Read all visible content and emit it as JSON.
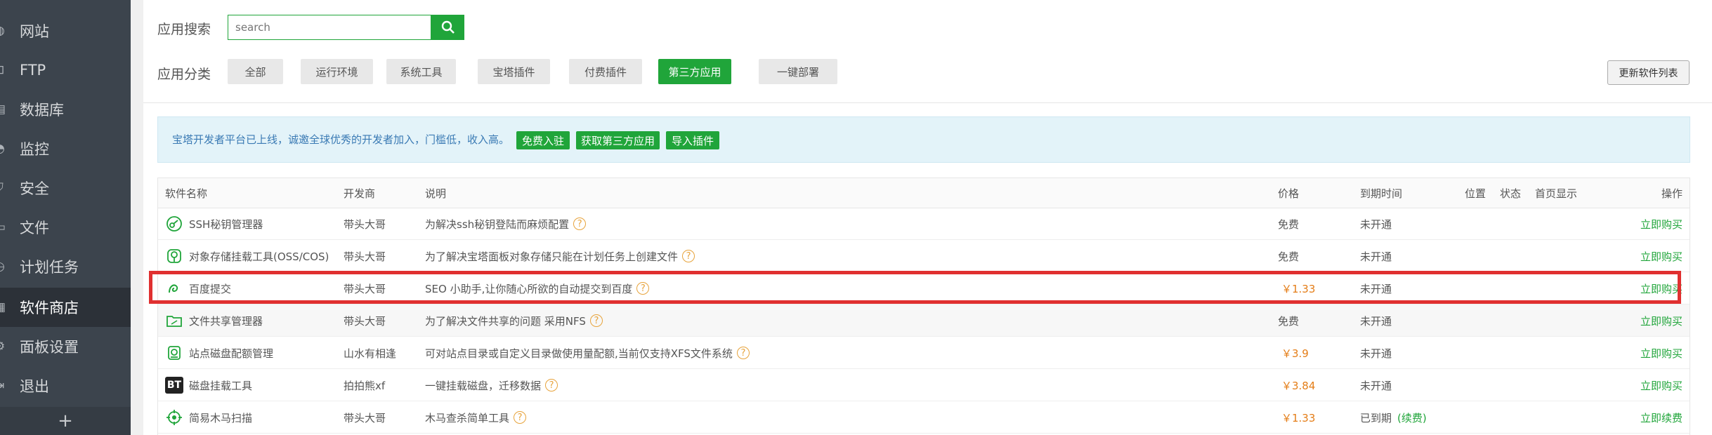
{
  "sidebar": {
    "items": [
      {
        "label": "网站",
        "icon": "globe-icon"
      },
      {
        "label": "FTP",
        "icon": "ftp-icon"
      },
      {
        "label": "数据库",
        "icon": "database-icon"
      },
      {
        "label": "监控",
        "icon": "monitor-icon"
      },
      {
        "label": "安全",
        "icon": "shield-icon"
      },
      {
        "label": "文件",
        "icon": "folder-icon"
      },
      {
        "label": "计划任务",
        "icon": "clock-icon"
      },
      {
        "label": "软件商店",
        "icon": "grid-icon",
        "active": true
      },
      {
        "label": "面板设置",
        "icon": "gear-icon"
      },
      {
        "label": "退出",
        "icon": "logout-icon"
      }
    ],
    "add_symbol": "+"
  },
  "search": {
    "label": "应用搜索",
    "placeholder": "search"
  },
  "category": {
    "label": "应用分类",
    "items": [
      "全部",
      "运行环境",
      "系统工具",
      "宝塔插件",
      "付费插件",
      "第三方应用",
      "一键部署"
    ],
    "active": "第三方应用"
  },
  "update_button": "更新软件列表",
  "notice": {
    "text": "宝塔开发者平台已上线，诚邀全球优秀的开发者加入，门槛低，收入高。",
    "buttons": [
      "免费入驻",
      "获取第三方应用",
      "导入插件"
    ]
  },
  "table": {
    "headers": [
      "软件名称",
      "开发商",
      "说明",
      "价格",
      "到期时间",
      "位置",
      "状态",
      "首页显示",
      "操作"
    ],
    "rows": [
      {
        "name": "SSH秘钥管理器",
        "icon": "key-circle-icon",
        "dev": "带头大哥",
        "desc": "为解决ssh秘钥登陆而麻烦配置",
        "price": "免费",
        "expire": "未开通",
        "action": "立即购买"
      },
      {
        "name": "对象存储挂载工具(OSS/COS)",
        "icon": "cloud-storage-icon",
        "dev": "带头大哥",
        "desc": "为了解决宝塔面板对象存储只能在计划任务上创建文件",
        "price": "免费",
        "expire": "未开通",
        "action": "立即购买"
      },
      {
        "name": "百度提交",
        "icon": "paw-icon",
        "dev": "带头大哥",
        "desc": "SEO 小助手,让你随心所欲的自动提交到百度",
        "price": "￥1.33",
        "expire": "未开通",
        "action": "立即购买"
      },
      {
        "name": "文件共享管理器",
        "icon": "shared-folder-icon",
        "dev": "带头大哥",
        "desc": "为了解决文件共享的问题 采用NFS",
        "price": "免费",
        "expire": "未开通",
        "action": "立即购买"
      },
      {
        "name": "站点磁盘配额管理",
        "icon": "disk-quota-icon",
        "dev": "山水有相逢",
        "desc": "可对站点目录或自定义目录做使用量配额,当前仅支持XFS文件系统",
        "price": "￥3.9",
        "expire": "未开通",
        "action": "立即购买"
      },
      {
        "name": "磁盘挂载工具",
        "icon": "bt-badge-icon",
        "icon_text": "BT",
        "dev": "拍拍熊xf",
        "desc": "一键挂载磁盘，迁移数据",
        "price": "￥3.84",
        "expire": "未开通",
        "action": "立即购买"
      },
      {
        "name": "简易木马扫描",
        "icon": "target-scan-icon",
        "dev": "带头大哥",
        "desc": "木马查杀简单工具",
        "price": "￥1.33",
        "expire": "已到期",
        "renew": "(续费)",
        "action": "立即续费"
      }
    ]
  },
  "colors": {
    "accent": "#20a53a",
    "sidebar_bg": "#3c444d",
    "paid_price": "#e47d17",
    "highlight": "#e03030"
  }
}
